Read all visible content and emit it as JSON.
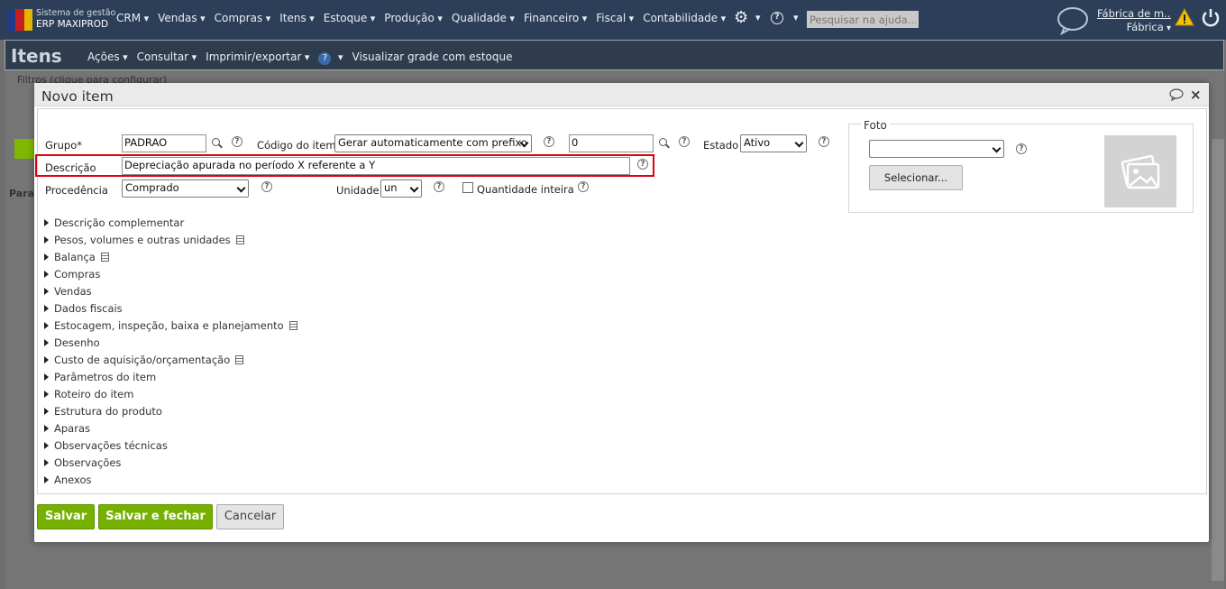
{
  "topbar": {
    "brand_line1": "Sistema de gestão",
    "brand_line2": "ERP MAXIPROD",
    "menu": [
      "CRM",
      "Vendas",
      "Compras",
      "Itens",
      "Estoque",
      "Produção",
      "Qualidade",
      "Financeiro",
      "Fiscal",
      "Contabilidade"
    ],
    "help_search_placeholder": "Pesquisar na ajuda...",
    "company_name": "Fábrica de m...",
    "company_short": "Fábrica",
    "icons": [
      "gear-icon",
      "help-icon",
      "chat-icon",
      "warning-icon",
      "power-icon"
    ]
  },
  "page": {
    "title": "Itens",
    "menu": {
      "acoes": "Ações",
      "consultar": "Consultar",
      "imprimir": "Imprimir/exportar",
      "visualizar": "Visualizar grade com estoque"
    },
    "filters_hint": "Filtros (clique para configurar)",
    "para_label": "Para"
  },
  "modal": {
    "title": "Novo item",
    "fields": {
      "grupo_label": "Grupo*",
      "grupo_value": "PADRAO",
      "codigo_label": "Código do item",
      "codigo_option": "Gerar automaticamente com prefixo",
      "codigo_number": "0",
      "estado_label": "Estado",
      "estado_value": "Ativo",
      "descricao_label": "Descrição",
      "descricao_value": "Depreciação apurada no período X referente a Y",
      "procedencia_label": "Procedência",
      "procedencia_value": "Comprado",
      "unidade_label": "Unidade",
      "unidade_value": "un",
      "quantidade_inteira_label": "Quantidade inteira"
    },
    "foto": {
      "label": "Foto",
      "select_value": "",
      "button": "Selecionar..."
    },
    "sections": [
      {
        "label": "Descrição complementar",
        "doc": false
      },
      {
        "label": "Pesos, volumes e outras unidades",
        "doc": true
      },
      {
        "label": "Balança",
        "doc": true
      },
      {
        "label": "Compras",
        "doc": false
      },
      {
        "label": "Vendas",
        "doc": false
      },
      {
        "label": "Dados fiscais",
        "doc": false
      },
      {
        "label": "Estocagem, inspeção, baixa e planejamento",
        "doc": true
      },
      {
        "label": "Desenho",
        "doc": false
      },
      {
        "label": "Custo de aquisição/orçamentação",
        "doc": true
      },
      {
        "label": "Parâmetros do item",
        "doc": false
      },
      {
        "label": "Roteiro do item",
        "doc": false
      },
      {
        "label": "Estrutura do produto",
        "doc": false
      },
      {
        "label": "Aparas",
        "doc": false
      },
      {
        "label": "Observações técnicas",
        "doc": false
      },
      {
        "label": "Observações",
        "doc": false
      },
      {
        "label": "Anexos",
        "doc": false
      }
    ],
    "buttons": {
      "salvar": "Salvar",
      "salvar_fechar": "Salvar e fechar",
      "cancelar": "Cancelar"
    }
  },
  "colors": {
    "navbar": "#2d3f58",
    "accent_green": "#76b001",
    "highlight_red": "#e00010"
  }
}
